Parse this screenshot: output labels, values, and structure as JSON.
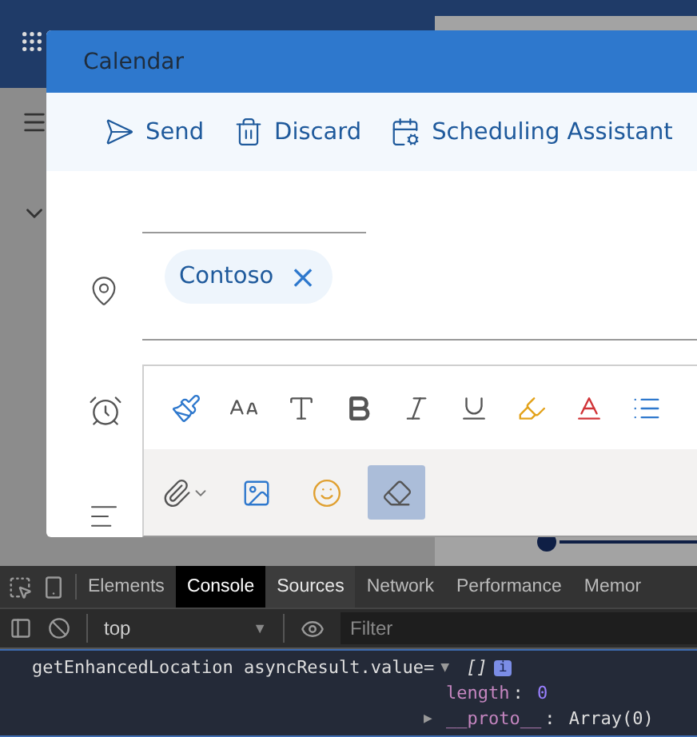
{
  "dialog": {
    "title": "Calendar",
    "actions": [
      {
        "kind": "send",
        "label": "Send"
      },
      {
        "kind": "discard",
        "label": "Discard"
      },
      {
        "kind": "schedule",
        "label": "Scheduling Assistant"
      }
    ],
    "location": {
      "chip": "Contoso",
      "remove": "×"
    },
    "format_tools": [
      {
        "kind": "brush",
        "selected": false
      },
      {
        "kind": "size",
        "selected": false
      },
      {
        "kind": "grow",
        "selected": false
      },
      {
        "kind": "bold",
        "selected": false
      },
      {
        "kind": "italic",
        "selected": false
      },
      {
        "kind": "underline",
        "selected": false
      },
      {
        "kind": "highlight",
        "selected": false
      },
      {
        "kind": "color",
        "selected": false
      },
      {
        "kind": "list",
        "selected": false
      }
    ],
    "insert_tools": [
      {
        "kind": "attach",
        "selected": false
      },
      {
        "kind": "image",
        "selected": false
      },
      {
        "kind": "emoji",
        "selected": false
      },
      {
        "kind": "clear",
        "selected": true
      }
    ]
  },
  "devtools": {
    "tabs": [
      {
        "label": "Elements",
        "selected": false,
        "hovered": false
      },
      {
        "label": "Console",
        "selected": true,
        "hovered": false
      },
      {
        "label": "Sources",
        "selected": false,
        "hovered": true
      },
      {
        "label": "Network",
        "selected": false,
        "hovered": false
      },
      {
        "label": "Performance",
        "selected": false,
        "hovered": false
      },
      {
        "label": "Memor",
        "selected": false,
        "hovered": false
      }
    ],
    "context": "top",
    "context_caret": "▼",
    "filter": {
      "placeholder": "Filter"
    },
    "log": {
      "message": "getEnhancedLocation asyncResult.value=",
      "toggle": "▼",
      "value": "[]",
      "info": "i",
      "properties": [
        {
          "key": "length",
          "sep": ":",
          "value": "0"
        },
        {
          "toggle": "▶",
          "key": "__proto__",
          "sep": ":",
          "value": "Array(0)"
        }
      ]
    }
  }
}
